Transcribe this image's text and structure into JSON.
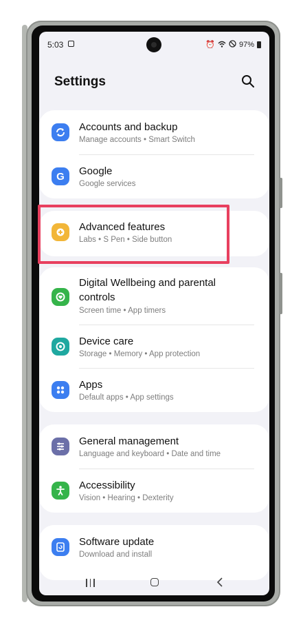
{
  "status_bar": {
    "time": "5:03",
    "battery": "97%"
  },
  "header": {
    "title": "Settings"
  },
  "items": [
    {
      "label": "Accounts and backup",
      "sub": "Manage accounts  •  Smart Switch",
      "color": "#3c7ef0",
      "icon": "sync-icon"
    },
    {
      "label": "Google",
      "sub": "Google services",
      "color": "#3c7ef0",
      "icon": "google-icon"
    },
    {
      "label": "Advanced features",
      "sub": "Labs  •  S Pen  •  Side button",
      "color": "#f2b638",
      "icon": "advanced-features-icon"
    },
    {
      "label": "Digital Wellbeing and parental",
      "label2": "controls",
      "sub": "Screen time  •  App timers",
      "color": "#35b44a",
      "icon": "wellbeing-icon"
    },
    {
      "label": "Device care",
      "sub": "Storage  •  Memory  •  App protection",
      "color": "#1fa8a0",
      "icon": "device-care-icon"
    },
    {
      "label": "Apps",
      "sub": "Default apps  •  App settings",
      "color": "#3c7ef0",
      "icon": "apps-icon"
    },
    {
      "label": "General management",
      "sub": "Language and keyboard  •  Date and time",
      "color": "#6b6fa8",
      "icon": "sliders-icon"
    },
    {
      "label": "Accessibility",
      "sub": "Vision  •  Hearing  •  Dexterity",
      "color": "#35b44a",
      "icon": "accessibility-icon"
    },
    {
      "label": "Software update",
      "sub": "Download and install",
      "color": "#3c7ef0",
      "icon": "software-update-icon"
    }
  ],
  "colors": {
    "highlight": "#e8405f",
    "background": "#f2f2f7"
  }
}
